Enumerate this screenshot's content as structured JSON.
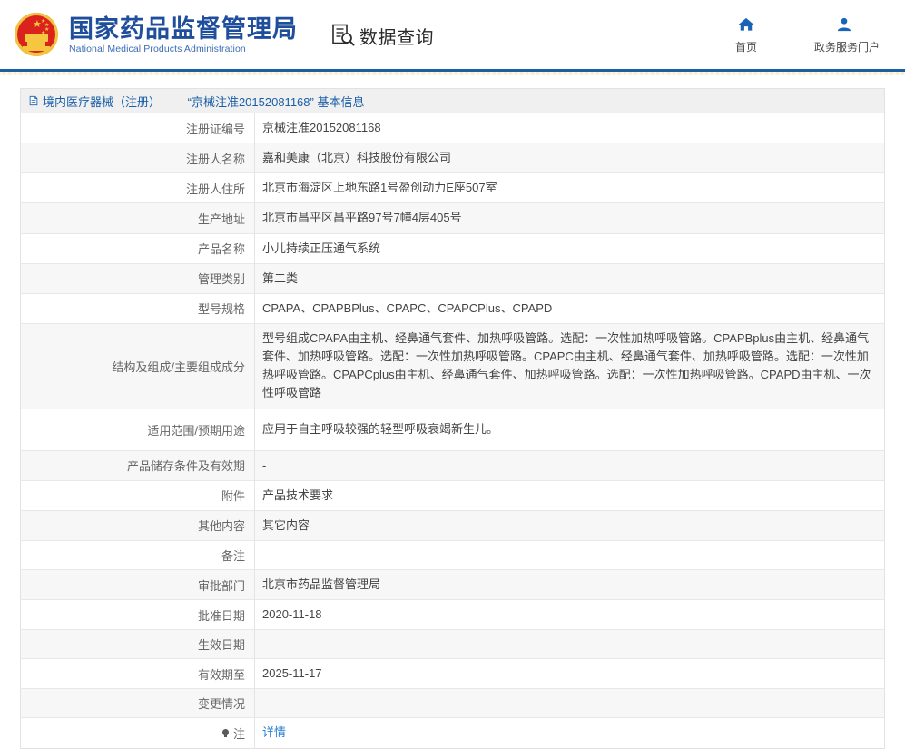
{
  "header": {
    "emblem_icon": "china-national-emblem",
    "brand_cn": "国家药品监督管理局",
    "brand_en": "National Medical Products Administration",
    "data_query_icon": "document-search-icon",
    "data_query_label": "数据查询",
    "nav": [
      {
        "icon": "home-icon",
        "label": "首页"
      },
      {
        "icon": "user-portal-icon",
        "label": "政务服务门户"
      }
    ],
    "accent_blue": "#1a5ea8",
    "brand_blue": "#1f4e9c"
  },
  "panel": {
    "title_icon": "document-icon",
    "title": "境内医疗器械（注册）—— “京械注准20152081168” 基本信息"
  },
  "table": {
    "rows": [
      {
        "label": "注册证编号",
        "value": "京械注准20152081168",
        "type": "text"
      },
      {
        "label": "注册人名称",
        "value": "嘉和美康（北京）科技股份有限公司",
        "type": "text"
      },
      {
        "label": "注册人住所",
        "value": "北京市海淀区上地东路1号盈创动力E座507室",
        "type": "text"
      },
      {
        "label": "生产地址",
        "value": "北京市昌平区昌平路97号7幢4层405号",
        "type": "text"
      },
      {
        "label": "产品名称",
        "value": "小儿持续正压通气系统",
        "type": "text"
      },
      {
        "label": "管理类别",
        "value": "第二类",
        "type": "text"
      },
      {
        "label": "型号规格",
        "value": "CPAPA、CPAPBPlus、CPAPC、CPAPCPlus、CPAPD",
        "type": "text"
      },
      {
        "label": "结构及组成/主要组成成分",
        "value": "型号组成CPAPA由主机、经鼻通气套件、加热呼吸管路。选配：一次性加热呼吸管路。CPAPBplus由主机、经鼻通气套件、加热呼吸管路。选配：一次性加热呼吸管路。CPAPC由主机、经鼻通气套件、加热呼吸管路。选配：一次性加热呼吸管路。CPAPCplus由主机、经鼻通气套件、加热呼吸管路。选配：一次性加热呼吸管路。CPAPD由主机、一次性呼吸管路",
        "type": "long"
      },
      {
        "label": "适用范围/预期用途",
        "value": "应用于自主呼吸较强的轻型呼吸衰竭新生儿。",
        "type": "mid"
      },
      {
        "label": "产品储存条件及有效期",
        "value": "-",
        "type": "text"
      },
      {
        "label": "附件",
        "value": "产品技术要求",
        "type": "text"
      },
      {
        "label": "其他内容",
        "value": "其它内容",
        "type": "text"
      },
      {
        "label": "备注",
        "value": "",
        "type": "text"
      },
      {
        "label": "审批部门",
        "value": "北京市药品监督管理局",
        "type": "text"
      },
      {
        "label": "批准日期",
        "value": "2020-11-18",
        "type": "text"
      },
      {
        "label": "生效日期",
        "value": "",
        "type": "text"
      },
      {
        "label": "有效期至",
        "value": "2025-11-17",
        "type": "text"
      },
      {
        "label": "变更情况",
        "value": "",
        "type": "text"
      },
      {
        "label": "注",
        "value": "详情",
        "type": "link",
        "icon": "bulb-icon"
      }
    ]
  }
}
